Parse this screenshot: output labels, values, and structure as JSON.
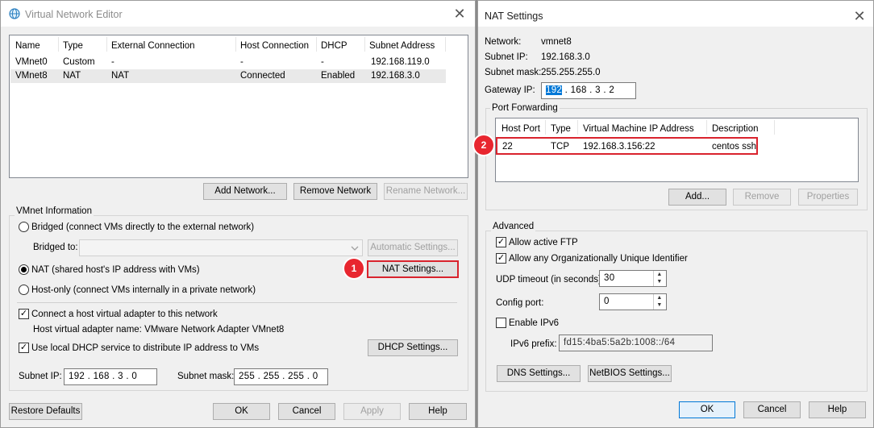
{
  "vne": {
    "title": "Virtual Network Editor",
    "columns": [
      "Name",
      "Type",
      "External Connection",
      "Host Connection",
      "DHCP",
      "Subnet Address"
    ],
    "rows": [
      [
        "VMnet0",
        "Custom",
        "-",
        "-",
        "-",
        "192.168.119.0"
      ],
      [
        "VMnet8",
        "NAT",
        "NAT",
        "Connected",
        "Enabled",
        "192.168.3.0"
      ]
    ],
    "add_network": "Add Network...",
    "remove_network": "Remove Network",
    "rename_network": "Rename Network...",
    "group_label": "VMnet Information",
    "bridged_label": "Bridged (connect VMs directly to the external network)",
    "bridged_to_label": "Bridged to:",
    "automatic_settings": "Automatic Settings...",
    "nat_label": "NAT (shared host's IP address with VMs)",
    "nat_settings": "NAT Settings...",
    "hostonly_label": "Host-only (connect VMs internally in a private network)",
    "connect_adapter_label": "Connect a host virtual adapter to this network",
    "adapter_name_label": "Host virtual adapter name: VMware Network Adapter VMnet8",
    "dhcp_label": "Use local DHCP service to distribute IP address to VMs",
    "dhcp_settings": "DHCP Settings...",
    "subnet_ip_label": "Subnet IP:",
    "subnet_ip": "192 . 168 .  3  .  0",
    "subnet_mask_label": "Subnet mask:",
    "subnet_mask": "255 . 255 . 255 .  0",
    "restore_defaults": "Restore Defaults",
    "ok": "OK",
    "cancel": "Cancel",
    "apply": "Apply",
    "help": "Help",
    "badge": "1"
  },
  "nat": {
    "title": "NAT Settings",
    "network_label": "Network:",
    "network_value": "vmnet8",
    "subnet_ip_label": "Subnet IP:",
    "subnet_ip_value": "192.168.3.0",
    "subnet_mask_label": "Subnet mask:",
    "subnet_mask_value": "255.255.255.0",
    "gateway_label": "Gateway IP:",
    "gateway_octet1": "192",
    "gateway_rest": " . 168 .  3  .  2",
    "pf_group": "Port Forwarding",
    "pf_columns": [
      "Host Port",
      "Type",
      "Virtual Machine IP Address",
      "Description"
    ],
    "pf_rows": [
      [
        "22",
        "TCP",
        "192.168.3.156:22",
        "centos ssh"
      ]
    ],
    "add": "Add...",
    "remove": "Remove",
    "properties": "Properties",
    "advanced_group": "Advanced",
    "allow_ftp": "Allow active FTP",
    "allow_oui": "Allow any Organizationally Unique Identifier",
    "udp_label": "UDP timeout (in seconds):",
    "udp_value": "30",
    "config_port_label": "Config port:",
    "config_port_value": "0",
    "enable_ipv6": "Enable IPv6",
    "ipv6_prefix_label": "IPv6 prefix:",
    "ipv6_prefix_value": "fd15:4ba5:5a2b:1008::/64",
    "dns_settings": "DNS Settings...",
    "netbios_settings": "NetBIOS Settings...",
    "ok": "OK",
    "cancel": "Cancel",
    "help": "Help",
    "badge": "2"
  },
  "icons": {
    "globe": "globe-icon",
    "close": "close-icon",
    "check": "✓",
    "dropdown": "chevron-down-icon"
  },
  "colors": {
    "highlight": "#d9232d",
    "selection": "#0078d7"
  }
}
